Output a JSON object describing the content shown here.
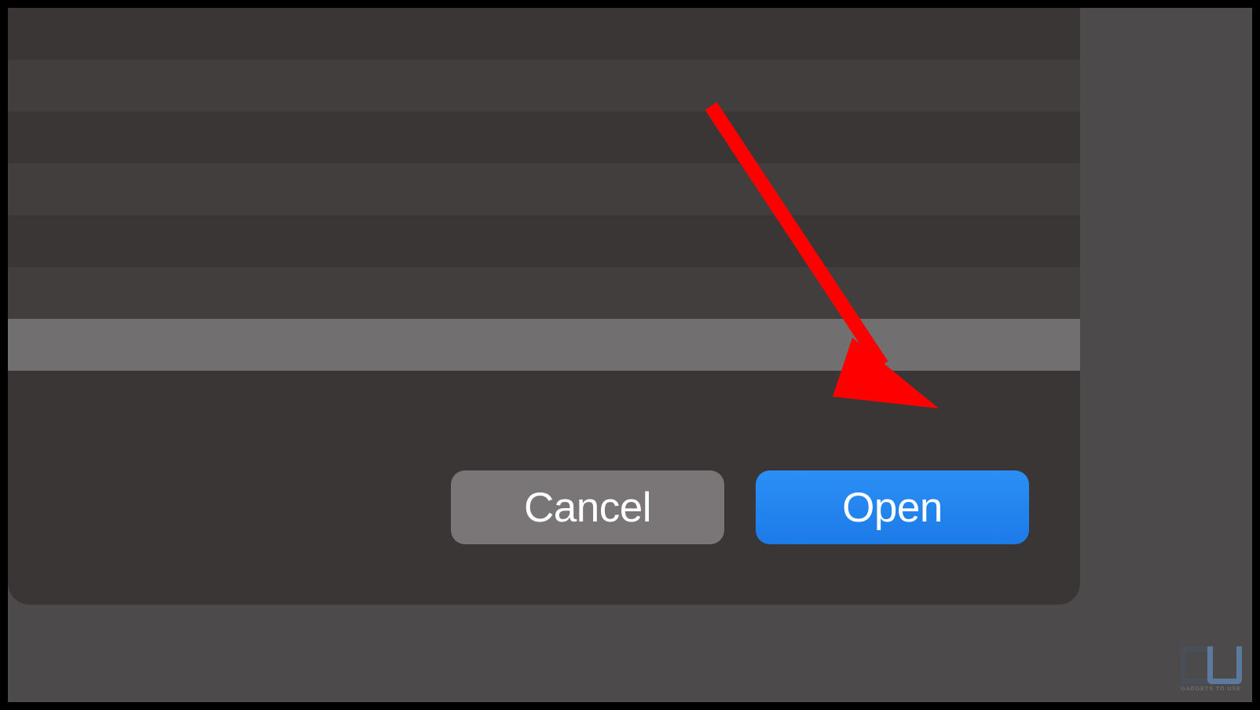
{
  "dialog": {
    "cancel_label": "Cancel",
    "open_label": "Open"
  },
  "watermark": {
    "text": "GADGETS TO USE"
  },
  "colors": {
    "accent_blue": "#2487f1",
    "cancel_gray": "#7a7677",
    "arrow_red": "#ff0000"
  }
}
